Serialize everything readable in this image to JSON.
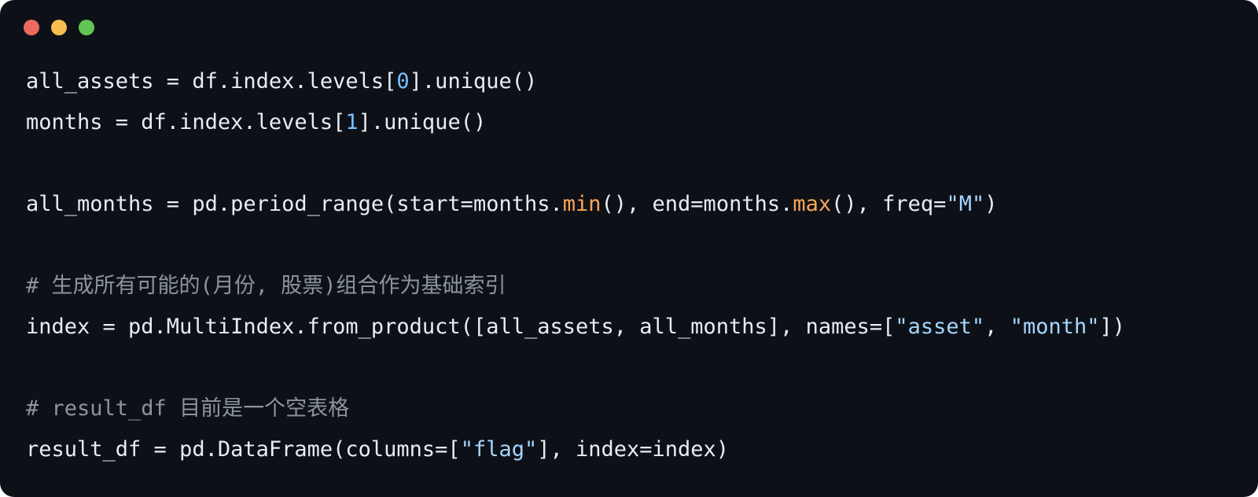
{
  "window": {
    "controls": [
      {
        "name": "close",
        "color": "#ee6a5f"
      },
      {
        "name": "minimize",
        "color": "#f5be4f"
      },
      {
        "name": "maximize",
        "color": "#61c454"
      }
    ]
  },
  "code": {
    "lines": [
      {
        "tokens": [
          {
            "t": "all_assets = df.index.levels[",
            "k": "plain"
          },
          {
            "t": "0",
            "k": "num"
          },
          {
            "t": "].unique()",
            "k": "plain"
          }
        ]
      },
      {
        "tokens": [
          {
            "t": "months = df.index.levels[",
            "k": "plain"
          },
          {
            "t": "1",
            "k": "num"
          },
          {
            "t": "].unique()",
            "k": "plain"
          }
        ]
      },
      {
        "tokens": []
      },
      {
        "tokens": [
          {
            "t": "all_months = pd.period_range(start=months.",
            "k": "plain"
          },
          {
            "t": "min",
            "k": "fn"
          },
          {
            "t": "(), end=months.",
            "k": "plain"
          },
          {
            "t": "max",
            "k": "fn"
          },
          {
            "t": "(), freq=",
            "k": "plain"
          },
          {
            "t": "\"M\"",
            "k": "str"
          },
          {
            "t": ")",
            "k": "plain"
          }
        ]
      },
      {
        "tokens": []
      },
      {
        "tokens": [
          {
            "t": "# 生成所有可能的(月份, 股票)组合作为基础索引",
            "k": "comment"
          }
        ]
      },
      {
        "tokens": [
          {
            "t": "index = pd.MultiIndex.from_product([all_assets, all_months], names=[",
            "k": "plain"
          },
          {
            "t": "\"asset\"",
            "k": "str"
          },
          {
            "t": ", ",
            "k": "plain"
          },
          {
            "t": "\"month\"",
            "k": "str"
          },
          {
            "t": "])",
            "k": "plain"
          }
        ]
      },
      {
        "tokens": []
      },
      {
        "tokens": [
          {
            "t": "# result_df 目前是一个空表格",
            "k": "comment"
          }
        ]
      },
      {
        "tokens": [
          {
            "t": "result_df = pd.DataFrame(columns=[",
            "k": "plain"
          },
          {
            "t": "\"flag\"",
            "k": "str"
          },
          {
            "t": "], index=index)",
            "k": "plain"
          }
        ]
      }
    ]
  }
}
